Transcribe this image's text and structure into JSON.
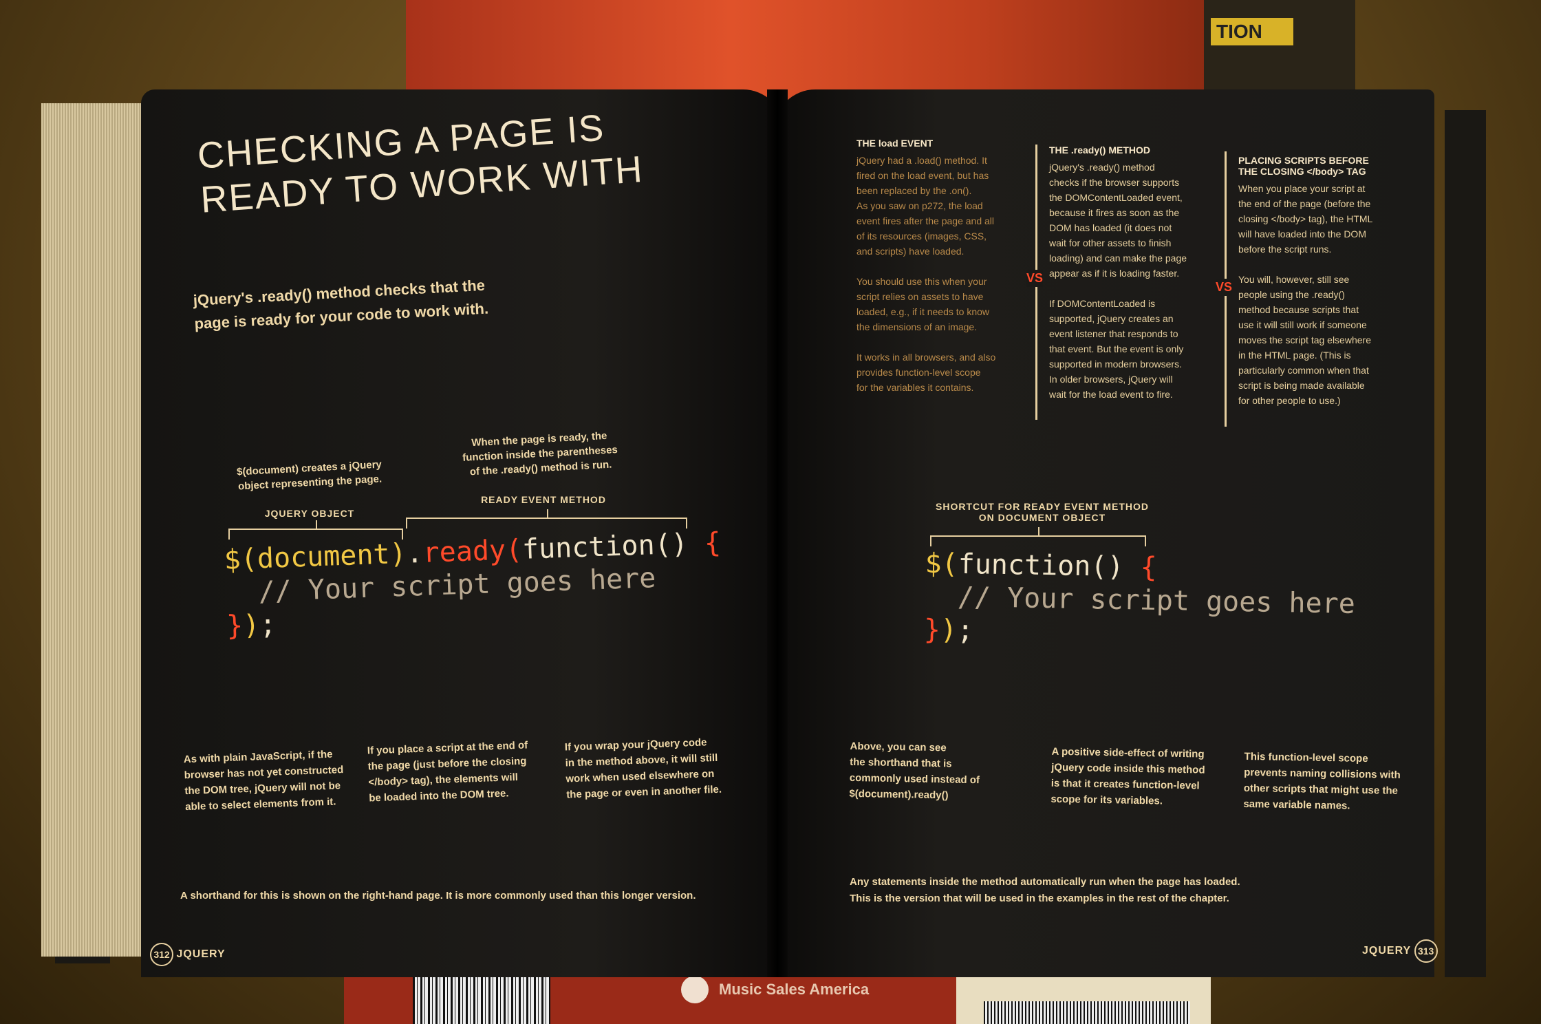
{
  "background": {
    "top_spine_text": "TION",
    "bottom_spine_text": "Music Sales America"
  },
  "left_page": {
    "title": "CHECKING A PAGE IS\nREADY TO WORK WITH",
    "intro": "jQuery's .ready() method checks that the\npage is ready for your code to work with.",
    "note_document": "$(document) creates a jQuery\nobject representing the page.",
    "label_jquery_object": "JQUERY OBJECT",
    "note_ready": "When the page is ready, the\nfunction inside the parentheses\nof the .ready() method is run.",
    "label_ready_event": "READY EVENT METHOD",
    "code": {
      "line1_doc": "$(document)",
      "line1_dot": ".",
      "line1_ready": "ready(",
      "line1_fn": "function() ",
      "line1_brace": "{",
      "line2": "  // Your script goes here",
      "line3_brace": "}",
      "line3_paren": ")",
      "line3_semi": ";"
    },
    "columns": [
      "As with plain JavaScript, if the\nbrowser has not yet constructed\nthe DOM tree, jQuery will not be\nable to select elements from it.",
      "If you place a script at the end of\nthe page (just before the closing\n</body> tag), the elements will\nbe loaded into the DOM tree.",
      "If you wrap your jQuery code\nin the method above, it will still\nwork when used elsewhere on\nthe page or even in another file."
    ],
    "footer": "A shorthand for this is shown on the right-hand page. It is more commonly used than this longer version.",
    "page_number": "312",
    "running_head": "JQUERY"
  },
  "right_page": {
    "col1_head": "THE load EVENT",
    "col1_body": "jQuery had a .load() method. It\nfired on the load event, but has\nbeen replaced by the .on().\nAs you saw on p272, the load\nevent fires after the page and all\nof its resources (images, CSS,\nand scripts) have loaded.",
    "col1_body2": "You should use this when your\nscript relies on assets to have\nloaded, e.g., if it needs to know\nthe dimensions of an image.",
    "col1_body3": "It works in all browsers, and also\nprovides function-level scope\nfor the variables it contains.",
    "col2_head": "THE .ready() METHOD",
    "col2_body": "jQuery's .ready() method\nchecks if the browser supports\nthe DOMContentLoaded event,\nbecause it fires as soon as the\nDOM has loaded (it does not\nwait for other assets to finish\nloading) and can make the page\nappear as if it is loading faster.",
    "col2_body2": "If DOMContentLoaded is\nsupported, jQuery creates an\nevent listener that responds to\nthat event. But the event is only\nsupported in modern browsers.\nIn older browsers, jQuery will\nwait for the load event to fire.",
    "col3_head": "PLACING SCRIPTS BEFORE\nTHE CLOSING </body> TAG",
    "col3_body": "When you place your script at\nthe end of the page (before the\nclosing </body> tag), the HTML\nwill have loaded into the DOM\nbefore the script runs.",
    "col3_body2": "You will, however, still see\npeople using the .ready()\nmethod because scripts that\nuse it will still work if someone\nmoves the script tag elsewhere\nin the HTML page. (This is\nparticularly common when that\nscript is being made available\nfor other people to use.)",
    "vs": "VS",
    "label_shortcut": "SHORTCUT FOR READY EVENT METHOD\nON DOCUMENT OBJECT",
    "code": {
      "line1_dollar": "$(",
      "line1_fn": "function() ",
      "line1_brace": "{",
      "line2": "  // Your script goes here",
      "line3_brace": "}",
      "line3_paren": ")",
      "line3_semi": ";"
    },
    "columns": [
      "Above, you can see\nthe shorthand that is\ncommonly used instead of\n$(document).ready()",
      "A positive side-effect of writing\njQuery code inside this method\nis that it creates function-level\nscope for its variables.",
      "This function-level scope\nprevents naming collisions with\nother scripts that might use the\nsame variable names."
    ],
    "footer": "Any statements inside the method automatically run when the page has loaded.\nThis is the version that will be used in the examples in the rest of the chapter.",
    "page_number": "313",
    "running_head": "JQUERY"
  }
}
